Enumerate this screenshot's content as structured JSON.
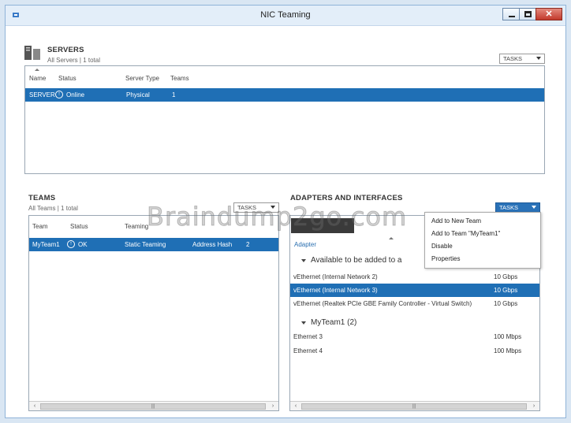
{
  "window": {
    "title": "NIC Teaming"
  },
  "servers": {
    "heading": "SERVERS",
    "subtitle": "All Servers | 1 total",
    "tasks_label": "TASKS",
    "columns": [
      "Name",
      "Status",
      "Server Type",
      "Teams"
    ],
    "rows": [
      {
        "name": "SERVER",
        "status": "Online",
        "type": "Physical",
        "teams": "1"
      }
    ]
  },
  "teams": {
    "heading": "TEAMS",
    "subtitle": "All Teams | 1 total",
    "tasks_label": "TASKS",
    "columns": [
      "Team",
      "Status",
      "Teaming"
    ],
    "rows": [
      {
        "team": "MyTeam1",
        "status": "OK",
        "mode": "Static Teaming",
        "balancing": "Address Hash",
        "adapters": "2"
      }
    ]
  },
  "adapters": {
    "heading": "ADAPTERS AND INTERFACES",
    "tasks_label": "TASKS",
    "column_adapter": "Adapter",
    "groups": [
      {
        "label": "Available to be added to a",
        "items": [
          {
            "name": "vEthernet (Internal Network 2)",
            "speed": "10 Gbps"
          },
          {
            "name": "vEthernet (Internal Network 3)",
            "speed": "10 Gbps"
          },
          {
            "name": "vEthernet (Realtek PCIe GBE Family Controller - Virtual Switch)",
            "speed": "10 Gbps"
          }
        ]
      },
      {
        "label": "MyTeam1 (2)",
        "items": [
          {
            "name": "Ethernet 3",
            "speed": "100 Mbps"
          },
          {
            "name": "Ethernet 4",
            "speed": "100 Mbps"
          }
        ]
      }
    ]
  },
  "tasks_menu": {
    "items": [
      "Add to New Team",
      "Add to Team \"MyTeam1\"",
      "Disable",
      "Properties"
    ]
  },
  "watermark": "Braindump2go.com",
  "colors": {
    "selection": "#1f6fb5",
    "tasks_active": "#2a72b8",
    "window_border": "#8fb3d8"
  }
}
